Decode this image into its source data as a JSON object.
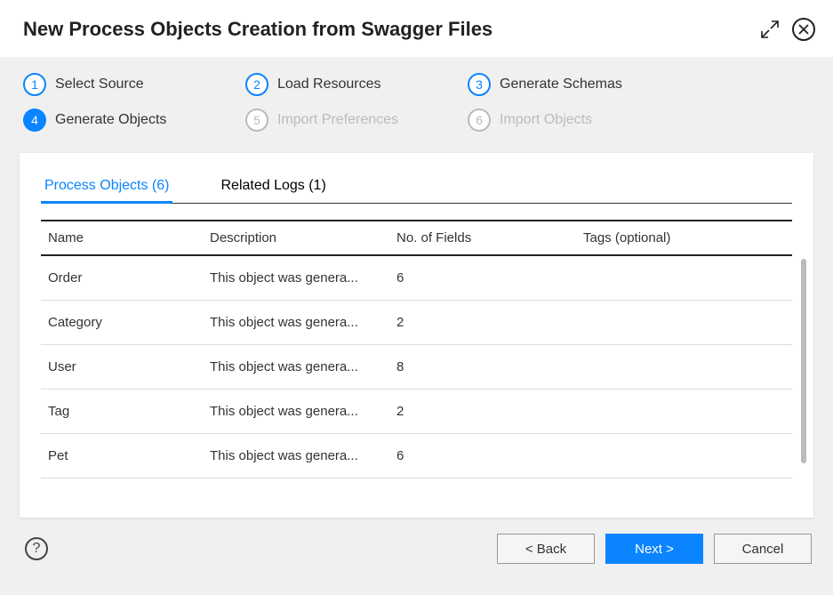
{
  "header": {
    "title": "New Process Objects Creation from Swagger Files"
  },
  "stepper": [
    {
      "num": "1",
      "label": "Select Source",
      "state": "completed"
    },
    {
      "num": "2",
      "label": "Load Resources",
      "state": "completed"
    },
    {
      "num": "3",
      "label": "Generate Schemas",
      "state": "completed"
    },
    {
      "num": "4",
      "label": "Generate Objects",
      "state": "active"
    },
    {
      "num": "5",
      "label": "Import Preferences",
      "state": "pending"
    },
    {
      "num": "6",
      "label": "Import Objects",
      "state": "pending"
    }
  ],
  "tabs": [
    {
      "label": "Process Objects (6)",
      "active": true
    },
    {
      "label": "Related Logs (1)",
      "active": false
    }
  ],
  "table": {
    "headers": {
      "name": "Name",
      "desc": "Description",
      "fields": "No. of Fields",
      "tags": "Tags (optional)"
    },
    "rows": [
      {
        "name": "Order",
        "desc": "This object was genera...",
        "fields": "6",
        "tags": ""
      },
      {
        "name": "Category",
        "desc": "This object was genera...",
        "fields": "2",
        "tags": ""
      },
      {
        "name": "User",
        "desc": "This object was genera...",
        "fields": "8",
        "tags": ""
      },
      {
        "name": "Tag",
        "desc": "This object was genera...",
        "fields": "2",
        "tags": ""
      },
      {
        "name": "Pet",
        "desc": "This object was genera...",
        "fields": "6",
        "tags": ""
      }
    ]
  },
  "footer": {
    "back": "< Back",
    "next": "Next >",
    "cancel": "Cancel",
    "help": "?"
  }
}
